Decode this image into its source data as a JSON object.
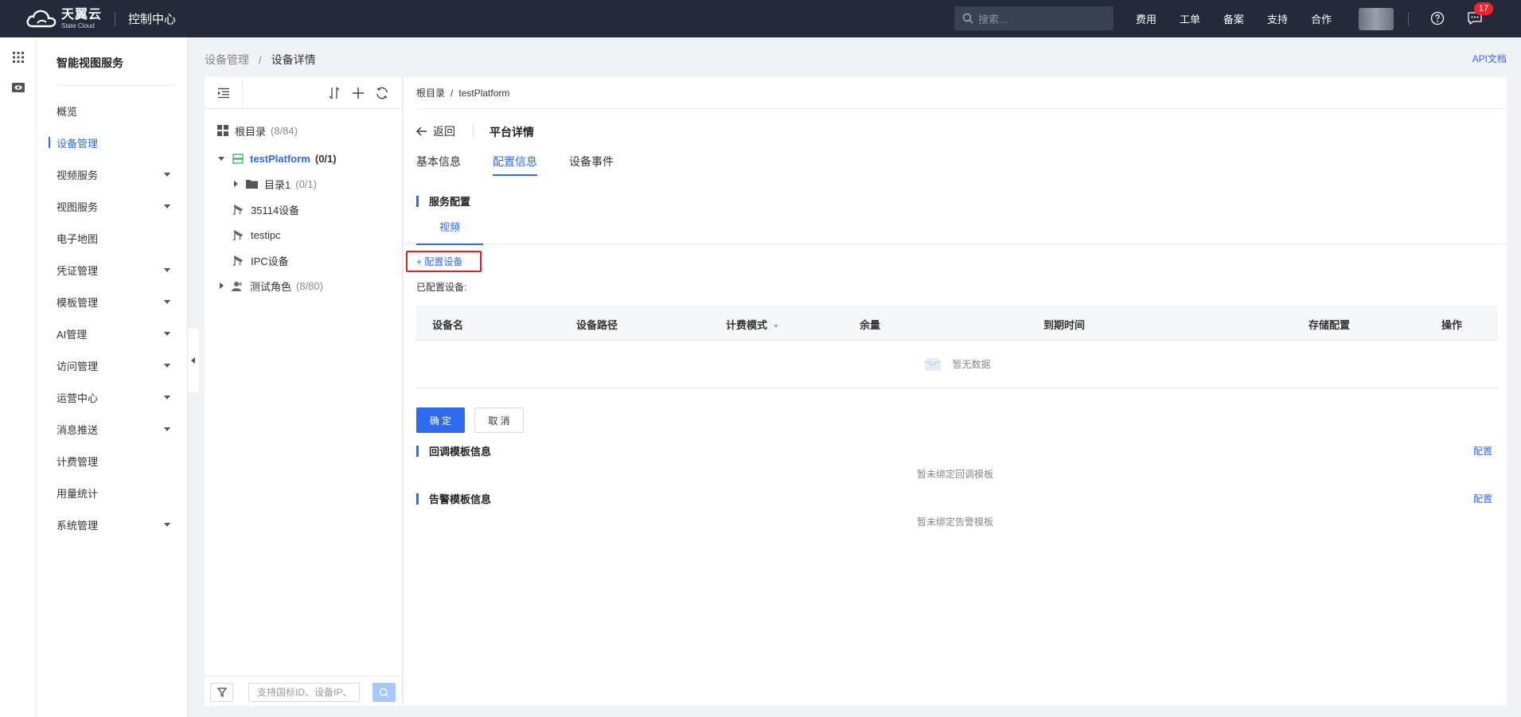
{
  "topbar": {
    "brand_cn": "天翼云",
    "brand_en": "State Cloud",
    "console_title": "控制中心",
    "search_placeholder": "搜索...",
    "nav": [
      "费用",
      "工单",
      "备案",
      "支持",
      "合作"
    ],
    "message_count": "17"
  },
  "sidebar": {
    "title": "智能视图服务",
    "items": [
      {
        "label": "概览"
      },
      {
        "label": "设备管理"
      },
      {
        "label": "视频服务"
      },
      {
        "label": "视图服务"
      },
      {
        "label": "电子地图"
      },
      {
        "label": "凭证管理"
      },
      {
        "label": "模板管理"
      },
      {
        "label": "AI管理"
      },
      {
        "label": "访问管理"
      },
      {
        "label": "运营中心"
      },
      {
        "label": "消息推送"
      },
      {
        "label": "计费管理"
      },
      {
        "label": "用量统计"
      },
      {
        "label": "系统管理"
      }
    ]
  },
  "breadcrumb": {
    "parent": "设备管理",
    "separator": "/",
    "current": "设备详情"
  },
  "api_doc": "API文档",
  "tree": {
    "root": {
      "label": "根目录",
      "count": "(8/84)"
    },
    "nodes": [
      {
        "label": "testPlatform",
        "count": "(0/1)"
      },
      {
        "label": "目录1",
        "count": "(0/1)"
      },
      {
        "label": "35114设备",
        "count": ""
      },
      {
        "label": "testipc",
        "count": ""
      },
      {
        "label": "IPC设备",
        "count": ""
      },
      {
        "label": "测试角色",
        "count": "(8/80)"
      }
    ],
    "search_placeholder": "支持国标ID、设备IP、"
  },
  "main": {
    "crumb_root": "根目录",
    "crumb_sep": "/",
    "crumb_current": "testPlatform",
    "back_label": "返回",
    "page_title": "平台详情",
    "tabs": [
      {
        "label": "基本信息"
      },
      {
        "label": "配置信息"
      },
      {
        "label": "设备事件"
      }
    ],
    "service_config_title": "服务配置",
    "subtab_video": "视频",
    "config_device_btn": "+ 配置设备",
    "configured_label": "已配置设备:",
    "table_columns": [
      "设备名",
      "设备路径",
      "计费模式",
      "余量",
      "到期时间",
      "存储配置",
      "操作"
    ],
    "table_empty": "暂无数据",
    "confirm_btn": "确 定",
    "cancel_btn": "取 消",
    "callback_title": "回调模板信息",
    "callback_config": "配置",
    "callback_empty": "暂未绑定回调模板",
    "alarm_title": "告警模板信息",
    "alarm_config": "配置",
    "alarm_empty": "暂未绑定告警模板"
  },
  "colors": {
    "topbar_bg": "#242a39",
    "accent": "#2f6bed",
    "highlight_border": "#e02020",
    "badge": "#f5222d"
  }
}
